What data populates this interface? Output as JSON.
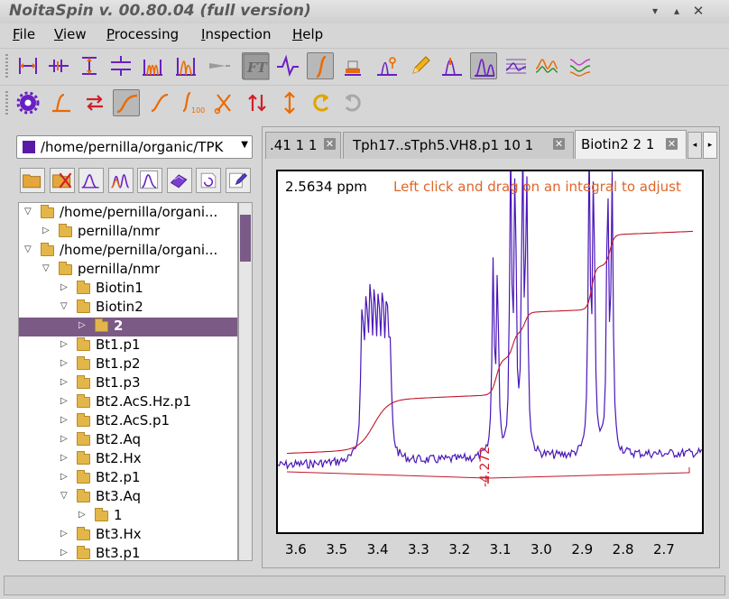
{
  "window": {
    "title": "NoitaSpin v. 00.80.04 (full version)",
    "buttons": [
      "minimize",
      "restore",
      "close"
    ]
  },
  "menu": [
    {
      "label": "File",
      "mnemonic": "F"
    },
    {
      "label": "View",
      "mnemonic": "V"
    },
    {
      "label": "Processing",
      "mnemonic": "P"
    },
    {
      "label": "Inspection",
      "mnemonic": "I"
    },
    {
      "label": "Help",
      "mnemonic": "H"
    }
  ],
  "toolbar1": [
    "hcursor-icon",
    "vcursor-icon",
    "ruler-icon",
    "spacing-icon",
    "multiplet-icon",
    "peak-pick-icon",
    "shadow-icon",
    "ft-icon",
    "phase-icon",
    "integrate-icon",
    "stamp-icon",
    "peak-label-icon",
    "pencil-icon",
    "peak-marker-icon",
    "spectrum-overlay-icon",
    "grid-icon",
    "stack-icon",
    "multi-trace-icon"
  ],
  "toolbar2": [
    "gear-icon",
    "baseline-icon",
    "swap-icon",
    "integral-curve-icon",
    "slope-icon",
    "integral-range-icon",
    "cut-icon",
    "up-down-arrows-icon",
    "vertical-arrow-icon",
    "undo-icon",
    "redo-icon"
  ],
  "sidebar": {
    "path": "/home/pernilla/organic/TPK",
    "swatch_color": "#5b1aa6",
    "file_tools": [
      "open-folder-icon",
      "close-folder-icon",
      "spectrum-icon",
      "multi-spectrum-icon",
      "spectrum-frame-icon",
      "3d-plot-icon",
      "rotate-icon",
      "edit-icon"
    ],
    "tree": [
      {
        "label": "/home/pernilla/organi...",
        "depth": 0,
        "twist": "open"
      },
      {
        "label": "pernilla/nmr",
        "depth": 1,
        "twist": "closed"
      },
      {
        "label": "/home/pernilla/organi...",
        "depth": 0,
        "twist": "open"
      },
      {
        "label": "pernilla/nmr",
        "depth": 1,
        "twist": "open"
      },
      {
        "label": "Biotin1",
        "depth": 2,
        "twist": "closed"
      },
      {
        "label": "Biotin2",
        "depth": 2,
        "twist": "open"
      },
      {
        "label": "2",
        "depth": 3,
        "twist": "closed",
        "selected": true
      },
      {
        "label": "Bt1.p1",
        "depth": 2,
        "twist": "closed"
      },
      {
        "label": "Bt1.p2",
        "depth": 2,
        "twist": "closed"
      },
      {
        "label": "Bt1.p3",
        "depth": 2,
        "twist": "closed"
      },
      {
        "label": "Bt2.AcS.Hz.p1",
        "depth": 2,
        "twist": "closed"
      },
      {
        "label": "Bt2.AcS.p1",
        "depth": 2,
        "twist": "closed"
      },
      {
        "label": "Bt2.Aq",
        "depth": 2,
        "twist": "closed"
      },
      {
        "label": "Bt2.Hx",
        "depth": 2,
        "twist": "closed"
      },
      {
        "label": "Bt2.p1",
        "depth": 2,
        "twist": "closed"
      },
      {
        "label": "Bt3.Aq",
        "depth": 2,
        "twist": "open"
      },
      {
        "label": "1",
        "depth": 3,
        "twist": "closed"
      },
      {
        "label": "Bt3.Hx",
        "depth": 2,
        "twist": "closed"
      },
      {
        "label": "Bt3.p1",
        "depth": 2,
        "twist": "closed"
      }
    ]
  },
  "tabs": [
    {
      "label": ".41 1 1",
      "active": false
    },
    {
      "label": "Tph17..sTph5.VH8.p1 10 1",
      "active": false
    },
    {
      "label": "Biotin2 2 1",
      "active": true
    }
  ],
  "plot": {
    "readout": "2.5634 ppm",
    "hint": "Left click and drag on an integral to adjust",
    "integral_label": "-4.272",
    "spectrum_color": "#4a16b8",
    "integral_color": "#c0182a",
    "x_ticks": [
      "3.6",
      "3.5",
      "3.4",
      "3.3",
      "3.2",
      "3.1",
      "3.0",
      "2.9",
      "2.8",
      "2.7"
    ]
  }
}
